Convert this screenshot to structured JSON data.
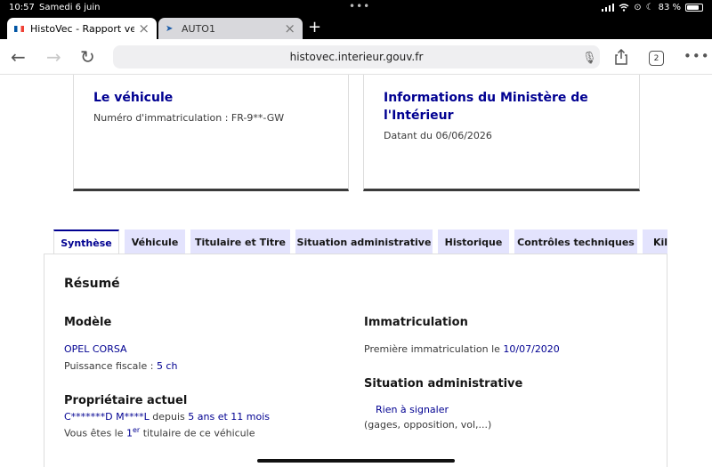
{
  "status": {
    "time": "10:57",
    "date": "Samedi 6 juin",
    "battery": "83 %",
    "battery_level": 0.83
  },
  "browser": {
    "tabs": [
      {
        "label": "HistoVec - Rapport vendeur"
      },
      {
        "label": "AUTO1"
      }
    ],
    "url": "histovec.interieur.gouv.fr",
    "tab_count": "2"
  },
  "cards": {
    "vehicle": {
      "title": "Le véhicule",
      "registration": "Numéro d'immatriculation : FR-9**-GW"
    },
    "ministry": {
      "title_line1": "Informations du Ministère de",
      "title_line2": "l'Intérieur",
      "date": "Datant du 06/06/2026"
    }
  },
  "page_tabs": [
    {
      "label": "Synthèse"
    },
    {
      "label": "Véhicule"
    },
    {
      "label": "Titulaire et Titre"
    },
    {
      "label": "Situation administrative"
    },
    {
      "label": "Historique"
    },
    {
      "label": "Contrôles techniques"
    },
    {
      "label": "Kilo"
    }
  ],
  "summary": {
    "title": "Résumé",
    "model": {
      "heading": "Modèle",
      "name": "OPEL CORSA",
      "power_label": "Puissance fiscale : ",
      "power_value": "5 ch"
    },
    "owner": {
      "heading": "Propriétaire actuel",
      "name": "C*******D M****L",
      "since_label": " depuis ",
      "since_value": "5 ans et 11 mois",
      "holder_prefix": "Vous êtes le ",
      "holder_number": "1",
      "holder_sup": "er",
      "holder_suffix": " titulaire de ce véhicule"
    },
    "registration": {
      "heading": "Immatriculation",
      "first_label": "Première immatriculation le ",
      "first_date": "10/07/2020"
    },
    "admin": {
      "heading": "Situation administrative",
      "status": "Rien à signaler",
      "detail": "(gages, opposition, vol,...)"
    }
  }
}
